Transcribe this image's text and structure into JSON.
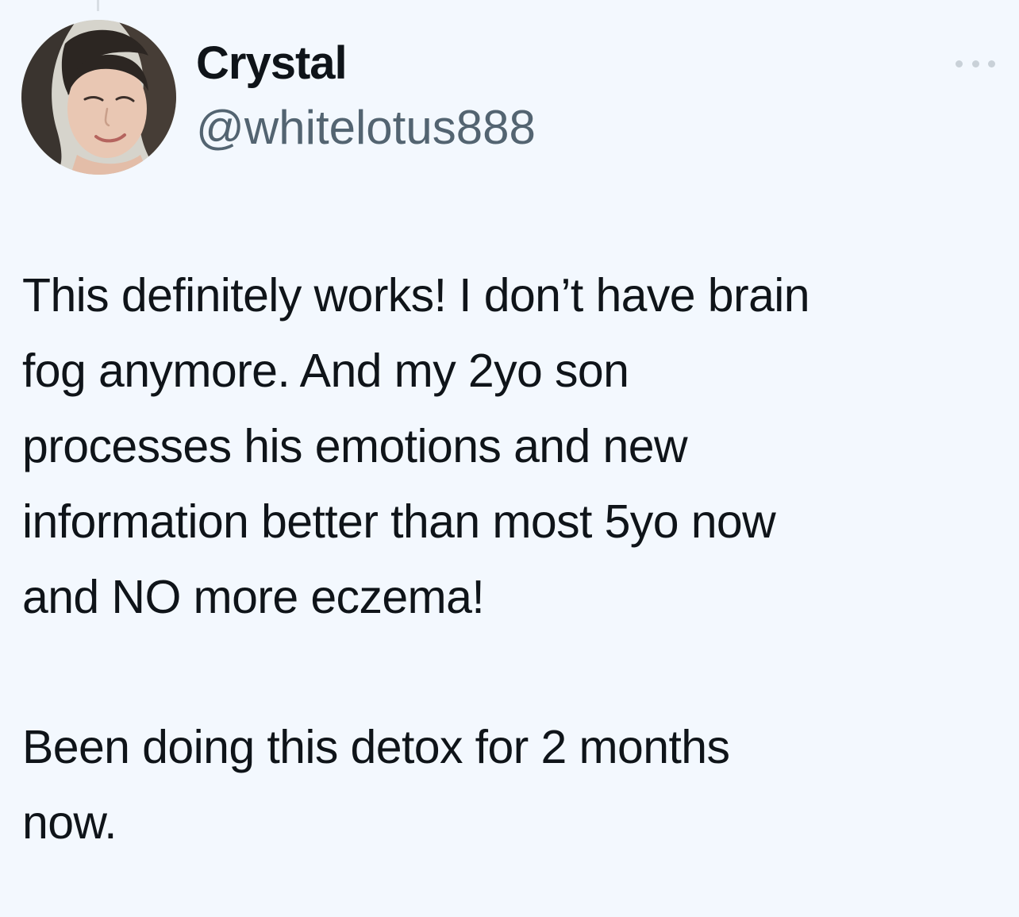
{
  "author": {
    "display_name": "Crystal",
    "handle": "@whitelotus888"
  },
  "header": {
    "more_icon": "more-horizontal-icon"
  },
  "tweet": {
    "paragraphs": [
      "This definitely works! I don’t have brain\nfog anymore. And my 2yo son\nprocesses his emotions and new\ninformation better than most 5yo now\nand NO more eczema!",
      "Been doing this detox for 2 months\nnow."
    ]
  },
  "colors": {
    "background": "#f3f8fe",
    "text_primary": "#0f1419",
    "text_secondary": "#536471",
    "icon_muted": "#c9d1d8"
  }
}
